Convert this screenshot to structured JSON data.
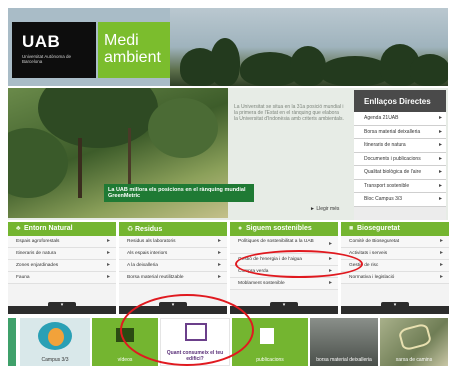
{
  "header": {
    "logo_main": "UAB",
    "logo_sub": "Universitat Autònoma de Barcelona",
    "brand_line1": "Medi",
    "brand_line2": "ambient"
  },
  "feature": {
    "photo_caption": "La UAB millora els posicions en el rànquing mundial GreenMetric",
    "intro_text": "La Universitat se situa en la 31a posició mundial i la primera de l'Estat en el rànquing que elabora la Universitat d'Indonèsia amb criteris ambientals.",
    "more_link": "Llegir més"
  },
  "direct_links": {
    "title": "Enllaços Directes",
    "items": [
      "Agenda 21UAB",
      "Borsa material deixalleria",
      "Itineraris de natura",
      "Documents i publicacions",
      "Qualitat biològica de l'aire",
      "Transport sostenible",
      "Bloc Campus 3/3"
    ]
  },
  "columns": [
    {
      "title": "Entorn Natural",
      "icon": "leaf-icon",
      "items": [
        "Espais agroforestals",
        "Itineraris de natura",
        "Zones enjardinades",
        "Fauna"
      ]
    },
    {
      "title": "Residus",
      "icon": "recycle-icon",
      "items": [
        "Residus als laboratoris",
        "Als espais interiors",
        "A la deixalleria",
        "Borsa material reutilitzable"
      ]
    },
    {
      "title": "Siguem sostenibles",
      "icon": "bulb-icon",
      "items": [
        "Polítiques de sostenibilitat a la UAB",
        "Gestió de l'energia i de l'aigua",
        "Compra verda",
        "Moblament sostenible"
      ]
    },
    {
      "title": "Bioseguretat",
      "icon": "shield-icon",
      "items": [
        "Comitè de Bioseguretat",
        "Activitats i serveis",
        "Gestió de risc",
        "Normativa i legislació"
      ]
    }
  ],
  "tiles": [
    {
      "label": "Campus 3/3",
      "name": "campus-tile"
    },
    {
      "label": "vídeos",
      "name": "videos-tile"
    },
    {
      "label": "Quant consumeix el teu edifici?",
      "name": "consumption-tile"
    },
    {
      "label": "publicacions",
      "name": "publications-tile"
    },
    {
      "label": "borsa material deixalleria",
      "name": "material-exchange-tile"
    },
    {
      "label": "xarxa de camins",
      "name": "paths-network-tile"
    }
  ],
  "colors": {
    "green": "#74b530",
    "dark": "#2c2c2c",
    "annotation": "#e0191f"
  }
}
